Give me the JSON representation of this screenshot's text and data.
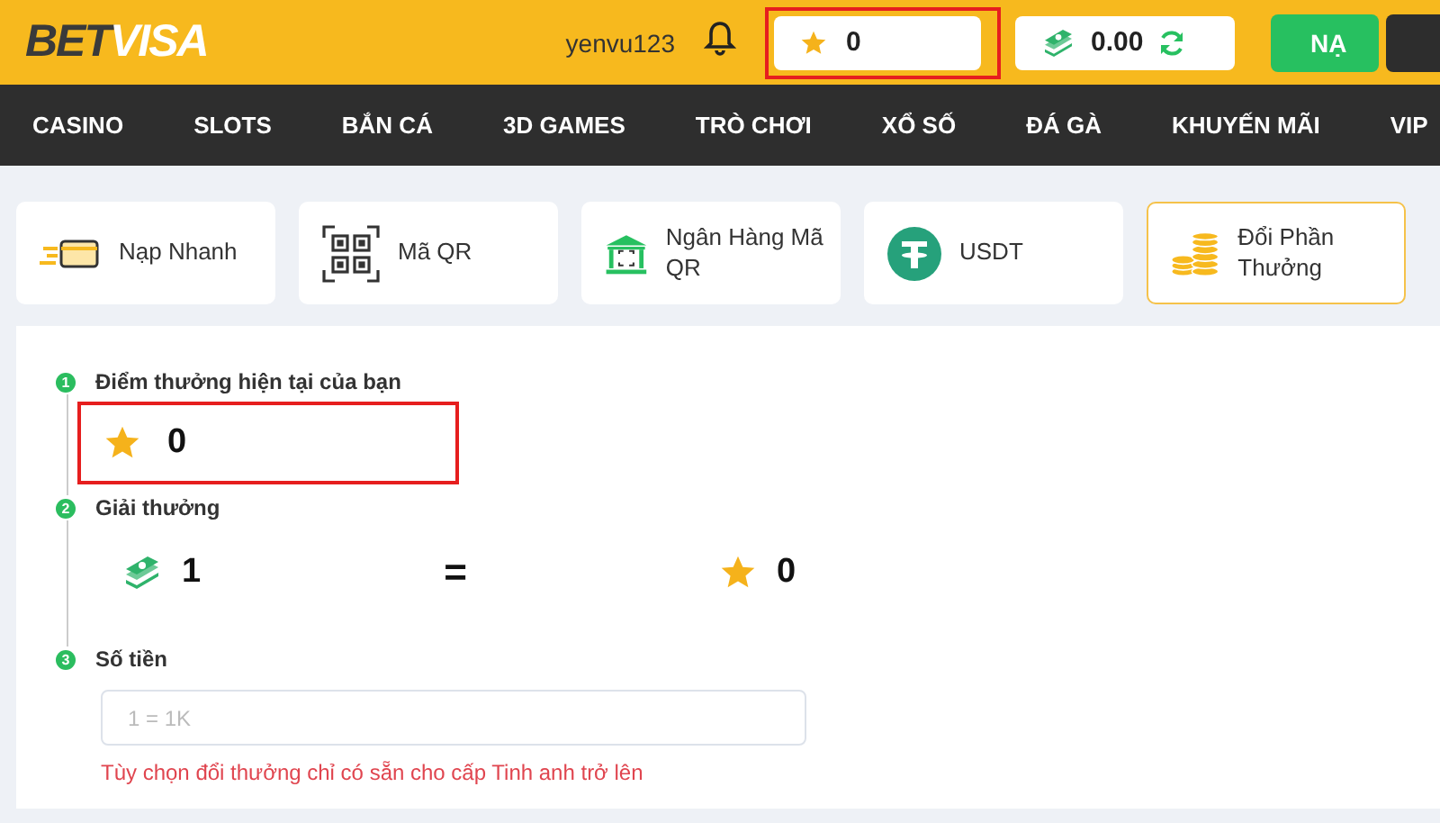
{
  "header": {
    "logo_bet": "BET",
    "logo_visa": "VISA",
    "username": "yenvu123",
    "points": "0",
    "points_highlighted": true,
    "balance": "0.00",
    "deposit_button": "NẠ"
  },
  "nav": [
    {
      "label": "CASINO"
    },
    {
      "label": "SLOTS"
    },
    {
      "label": "BẮN CÁ"
    },
    {
      "label": "3D GAMES"
    },
    {
      "label": "TRÒ CHƠI"
    },
    {
      "label": "XỔ SỐ"
    },
    {
      "label": "ĐÁ GÀ"
    },
    {
      "label": "KHUYẾN MÃI"
    },
    {
      "label": "VIP"
    }
  ],
  "methods": [
    {
      "label": "Nạp Nhanh",
      "kind": "card",
      "selected": false
    },
    {
      "label": "Mã QR",
      "kind": "qr",
      "selected": false
    },
    {
      "label": "Ngân Hàng Mã QR",
      "kind": "bank",
      "selected": false
    },
    {
      "label": "USDT",
      "kind": "usdt",
      "selected": false
    },
    {
      "label": "Đổi Phần Thưởng",
      "kind": "coins",
      "selected": true
    }
  ],
  "steps": [
    {
      "number": "1",
      "title": "Điểm thưởng hiện tại của bạn",
      "kind": "points",
      "value": "0",
      "highlighted": true
    },
    {
      "number": "2",
      "title": "Giải thưởng",
      "kind": "rate",
      "cash": "1",
      "equals": "=",
      "points": "0"
    },
    {
      "number": "3",
      "title": "Số tiền",
      "kind": "amount",
      "placeholder": "1 = 1K",
      "note": "Tùy chọn đổi thưởng chỉ có sẵn cho cấp Tinh anh trở lên"
    }
  ]
}
